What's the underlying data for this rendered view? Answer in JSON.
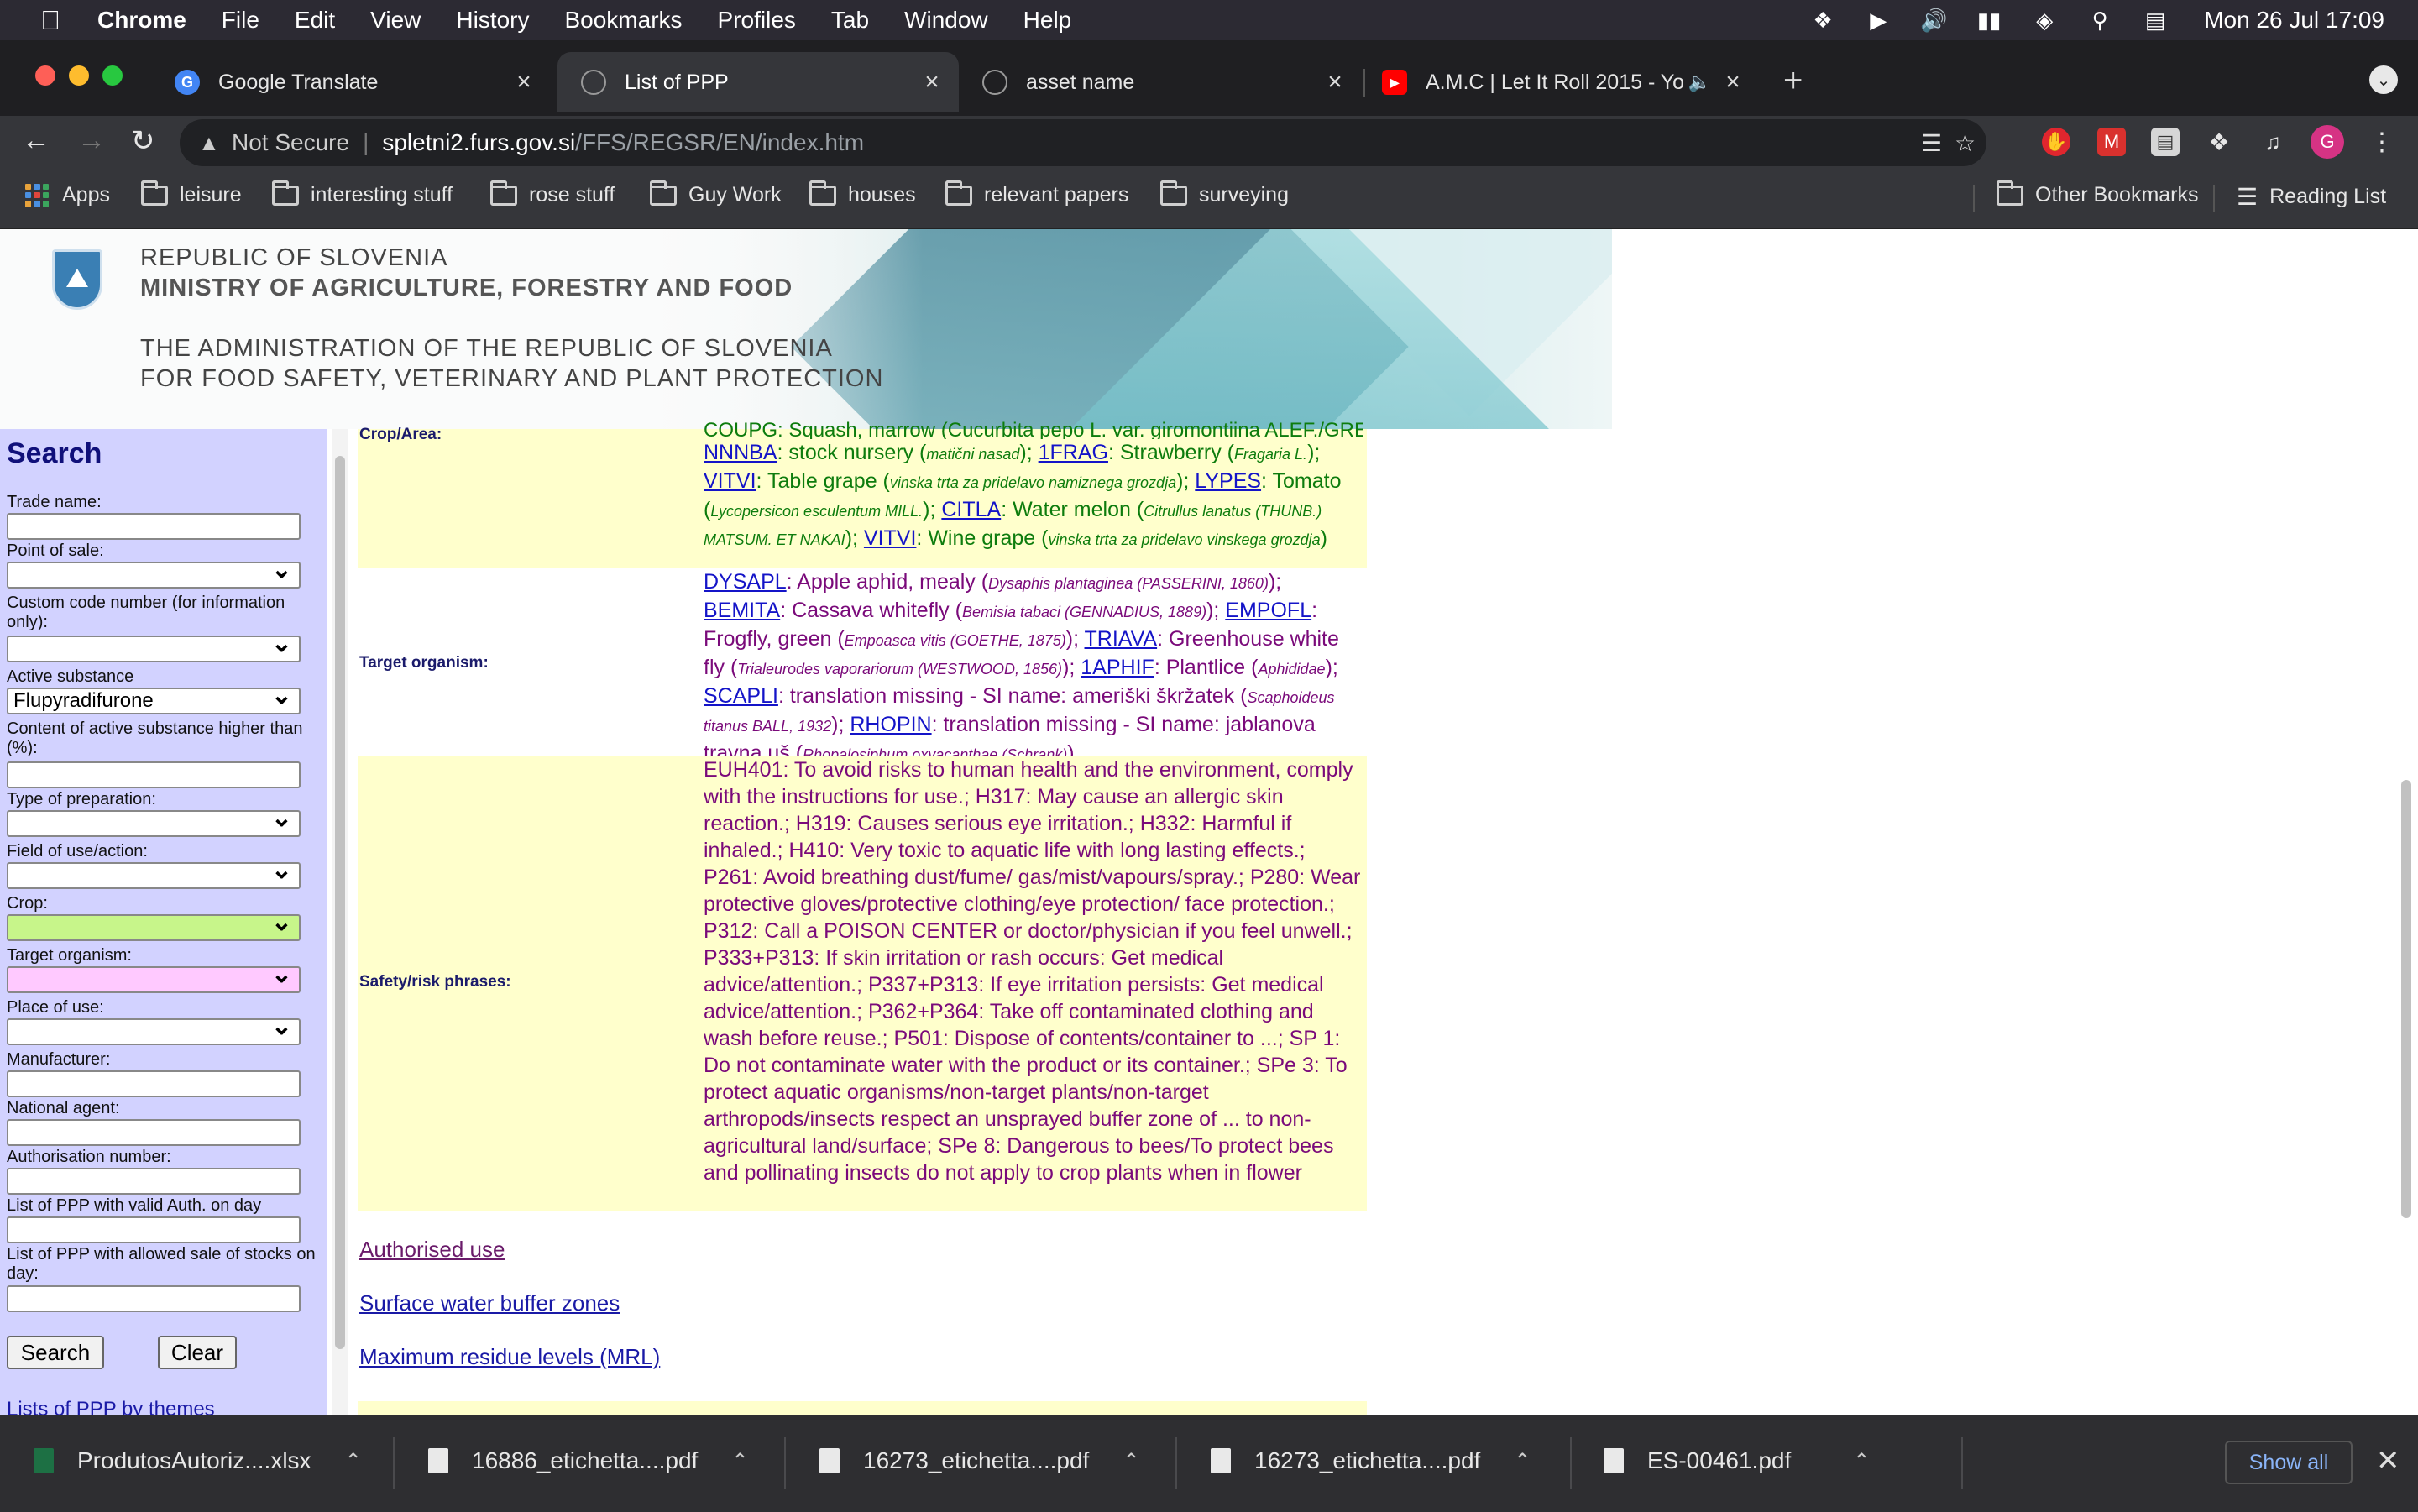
{
  "menubar": {
    "app_name": "Chrome",
    "items": [
      "File",
      "Edit",
      "View",
      "History",
      "Bookmarks",
      "Profiles",
      "Tab",
      "Window",
      "Help"
    ],
    "clock": "Mon 26 Jul  17:09"
  },
  "tabs": [
    {
      "title": "Google Translate"
    },
    {
      "title": "List of PPP"
    },
    {
      "title": "asset name"
    },
    {
      "title": "A.M.C | Let It Roll 2015 - Yo"
    }
  ],
  "address": {
    "security": "Not Secure",
    "host": "spletni2.furs.gov.si",
    "path": "/FFS/REGSR/EN/index.htm"
  },
  "bookmarks": {
    "apps": "Apps",
    "folders": [
      "leisure",
      "interesting stuff",
      "rose stuff",
      "Guy Work",
      "houses",
      "relevant papers",
      "surveying"
    ],
    "other": "Other Bookmarks",
    "reading_list": "Reading List"
  },
  "profile_initial": "G",
  "banner": {
    "line1": "REPUBLIC OF SLOVENIA",
    "line2": "MINISTRY OF AGRICULTURE, FORESTRY AND FOOD",
    "line3": "THE ADMINISTRATION OF THE REPUBLIC OF SLOVENIA",
    "line4": "FOR FOOD SAFETY, VETERINARY AND PLANT PROTECTION"
  },
  "search": {
    "heading": "Search",
    "trade_name": "Trade name:",
    "point_of_sale": "Point of sale:",
    "custom_code": "Custom code number (for information only):",
    "active_substance": "Active substance",
    "active_substance_value": "Flupyradifurone",
    "content_higher": "Content of active substance higher than (%):",
    "type_of_preparation": "Type of preparation:",
    "field_of_use": "Field of use/action:",
    "crop": "Crop:",
    "target_organism": "Target organism:",
    "place_of_use": "Place of use:",
    "manufacturer": "Manufacturer:",
    "national_agent": "National agent:",
    "authorisation_number": "Authorisation number:",
    "valid_auth": "List of PPP with valid Auth. on day",
    "allowed_sale": "List of PPP with allowed sale of stocks on day:",
    "search_button": "Search",
    "clear_button": "Clear",
    "themes_link": "Lists of PPP by themes"
  },
  "content": {
    "crop_label": "Crop/Area:",
    "crop_partial": "COUPG: Squash, marrow (Cucurbita pepo L. var. giromontiina ALEF./GREB.);",
    "crop_entries": [
      {
        "code": "NNNBA",
        "name": "stock nursery",
        "latin": "matični nasad"
      },
      {
        "code": "1FRAG",
        "name": "Strawberry",
        "latin": "Fragaria L."
      },
      {
        "code": "VITVI",
        "name": "Table grape",
        "latin": "vinska trta za pridelavo namiznega grozdja"
      },
      {
        "code": "LYPES",
        "name": "Tomato",
        "latin": "Lycopersicon esculentum MILL."
      },
      {
        "code": "CITLA",
        "name": "Water melon",
        "latin": "Citrullus lanatus (THUNB.) MATSUM. ET NAKAI"
      },
      {
        "code": "VITVI",
        "name": "Wine grape",
        "latin": "vinska trta za pridelavo vinskega grozdja"
      }
    ],
    "target_label": "Target organism:",
    "target_entries": [
      {
        "code": "DYSAPL",
        "name": "Apple aphid, mealy",
        "latin": "Dysaphis plantaginea (PASSERINI, 1860)"
      },
      {
        "code": "BEMITA",
        "name": "Cassava whitefly",
        "latin": "Bemisia tabaci (GENNADIUS, 1889)"
      },
      {
        "code": "EMPOFL",
        "name": "Frogfly, green",
        "latin": "Empoasca vitis (GOETHE, 1875)"
      },
      {
        "code": "TRIAVA",
        "name": "Greenhouse white fly",
        "latin": "Trialeurodes vaporariorum (WESTWOOD, 1856)"
      },
      {
        "code": "1APHIF",
        "name": "Plantlice",
        "latin": "Aphididae"
      },
      {
        "code": "SCAPLI",
        "name": "translation missing - SI name: ameriški škržatek",
        "latin": "Scaphoideus titanus BALL, 1932"
      },
      {
        "code": "RHOPIN",
        "name": "translation missing - SI name: jablanova travna uš",
        "latin": "Rhopalosiphum oxyacanthae (Schrank)"
      }
    ],
    "safety_label": "Safety/risk phrases:",
    "safety_text": "EUH401: To avoid risks to human health and the environment, comply with the instructions for use.; H317: May cause an allergic skin reaction.; H319: Causes serious eye irritation.; H332: Harmful if inhaled.; H410: Very toxic to aquatic life with long lasting effects.; P261: Avoid breathing dust/fume/ gas/mist/vapours/spray.; P280: Wear protective gloves/protective clothing/eye protection/ face protection.; P312: Call a POISON CENTER or doctor/physician if you feel unwell.; P333+P313: If skin irritation or rash occurs: Get medical advice/attention.; P337+P313: If eye irritation persists: Get medical advice/attention.; P362+P364: Take off contaminated clothing and wash before reuse.; P501: Dispose of contents/container to ...; SP 1: Do not contaminate water with the product or its container.; SPe 3: To protect aquatic organisms/non-target plants/non-target arthropods/insects respect an unsprayed buffer zone of ... to non-agricultural land/surface; SPe 8: Dangerous to bees/To protect bees and pollinating insects do not apply to crop plants when in flower",
    "links": [
      "Authorised use",
      "Surface water buffer zones",
      "Maximum residue levels (MRL)"
    ]
  },
  "downloads": {
    "items": [
      "ProdutosAutoriz....xlsx",
      "16886_etichetta....pdf",
      "16273_etichetta....pdf",
      "16273_etichetta....pdf",
      "ES-00461.pdf"
    ],
    "show_all": "Show all"
  }
}
